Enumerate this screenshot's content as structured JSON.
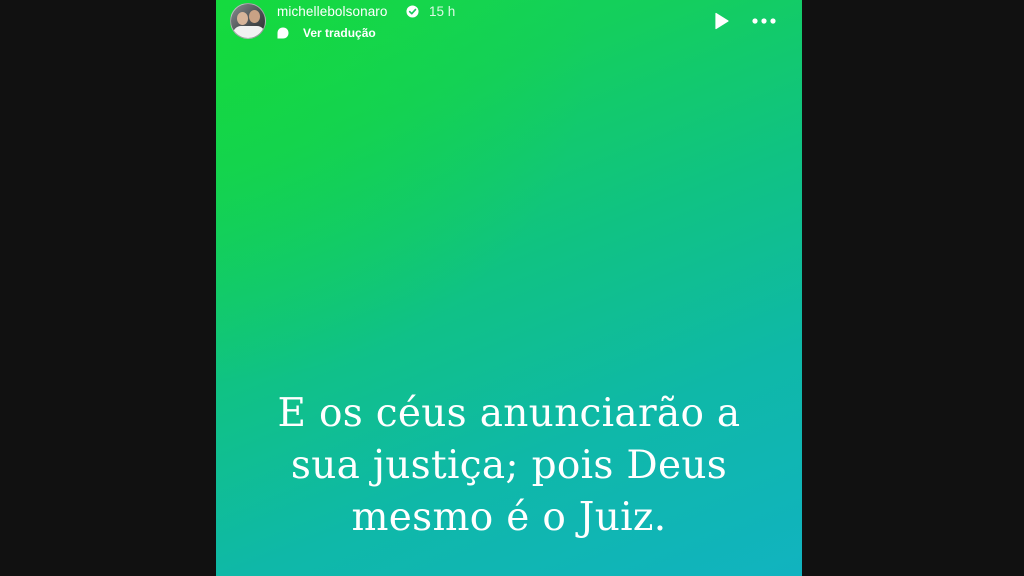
{
  "story": {
    "username": "michellebolsonaro",
    "time_ago": "15 h",
    "translate_label": "Ver tradução",
    "text_lines": [
      "E os céus anunciarão a",
      "sua justiça; pois Deus",
      "mesmo é o Juiz."
    ],
    "gradient_colors": [
      "#16d84a",
      "#10c284",
      "#11b3c0"
    ]
  },
  "icons": {
    "verified": "verified-badge-icon",
    "translate": "translate-icon",
    "play": "play-icon",
    "more": "more-options-icon"
  }
}
